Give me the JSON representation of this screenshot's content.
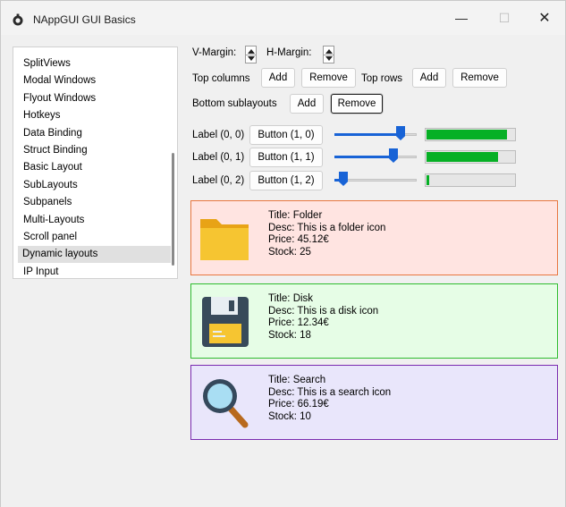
{
  "window": {
    "title": "NAppGUI GUI Basics",
    "controls": {
      "minimize": "—",
      "maximize": "☐",
      "close": "✕"
    }
  },
  "sidebar": {
    "items": [
      "SplitViews",
      "Modal Windows",
      "Flyout Windows",
      "Hotkeys",
      "Data Binding",
      "Struct Binding",
      "Basic Layout",
      "SubLayouts",
      "Subpanels",
      "Multi-Layouts",
      "Scroll panel",
      "Dynamic layouts",
      "IP Input"
    ],
    "selected": "Dynamic layouts"
  },
  "margins": {
    "v_label": "V-Margin:",
    "h_label": "H-Margin:"
  },
  "columns": {
    "label": "Top columns",
    "add": "Add",
    "remove": "Remove"
  },
  "rows": {
    "label": "Top rows",
    "add": "Add",
    "remove": "Remove"
  },
  "bottom": {
    "label": "Bottom sublayouts",
    "add": "Add",
    "remove": "Remove"
  },
  "grid": [
    {
      "label": "Label (0, 0)",
      "button": "Button (1, 0)",
      "slider": 0.84,
      "progress": 0.92
    },
    {
      "label": "Label (0, 1)",
      "button": "Button (1, 1)",
      "slider": 0.74,
      "progress": 0.82
    },
    {
      "label": "Label (0, 2)",
      "button": "Button (1, 2)",
      "slider": 0.06,
      "progress": 0.03
    }
  ],
  "cards": [
    {
      "icon": "folder-icon",
      "title": "Title: Folder",
      "desc": "Desc: This is a folder icon",
      "price": "Price: 45.12€",
      "stock": "Stock: 25",
      "bg": "#ffe4e1",
      "border": "#e8763f"
    },
    {
      "icon": "disk-icon",
      "title": "Title: Disk",
      "desc": "Desc: This is a disk icon",
      "price": "Price: 12.34€",
      "stock": "Stock: 18",
      "bg": "#e6fde6",
      "border": "#2ebd2e"
    },
    {
      "icon": "search-icon",
      "title": "Title: Search",
      "desc": "Desc: This is a search icon",
      "price": "Price: 66.19€",
      "stock": "Stock: 10",
      "bg": "#e9e6fb",
      "border": "#7a2bb0"
    }
  ],
  "colors": {
    "accent": "#1863d6",
    "progress": "#06b025"
  }
}
